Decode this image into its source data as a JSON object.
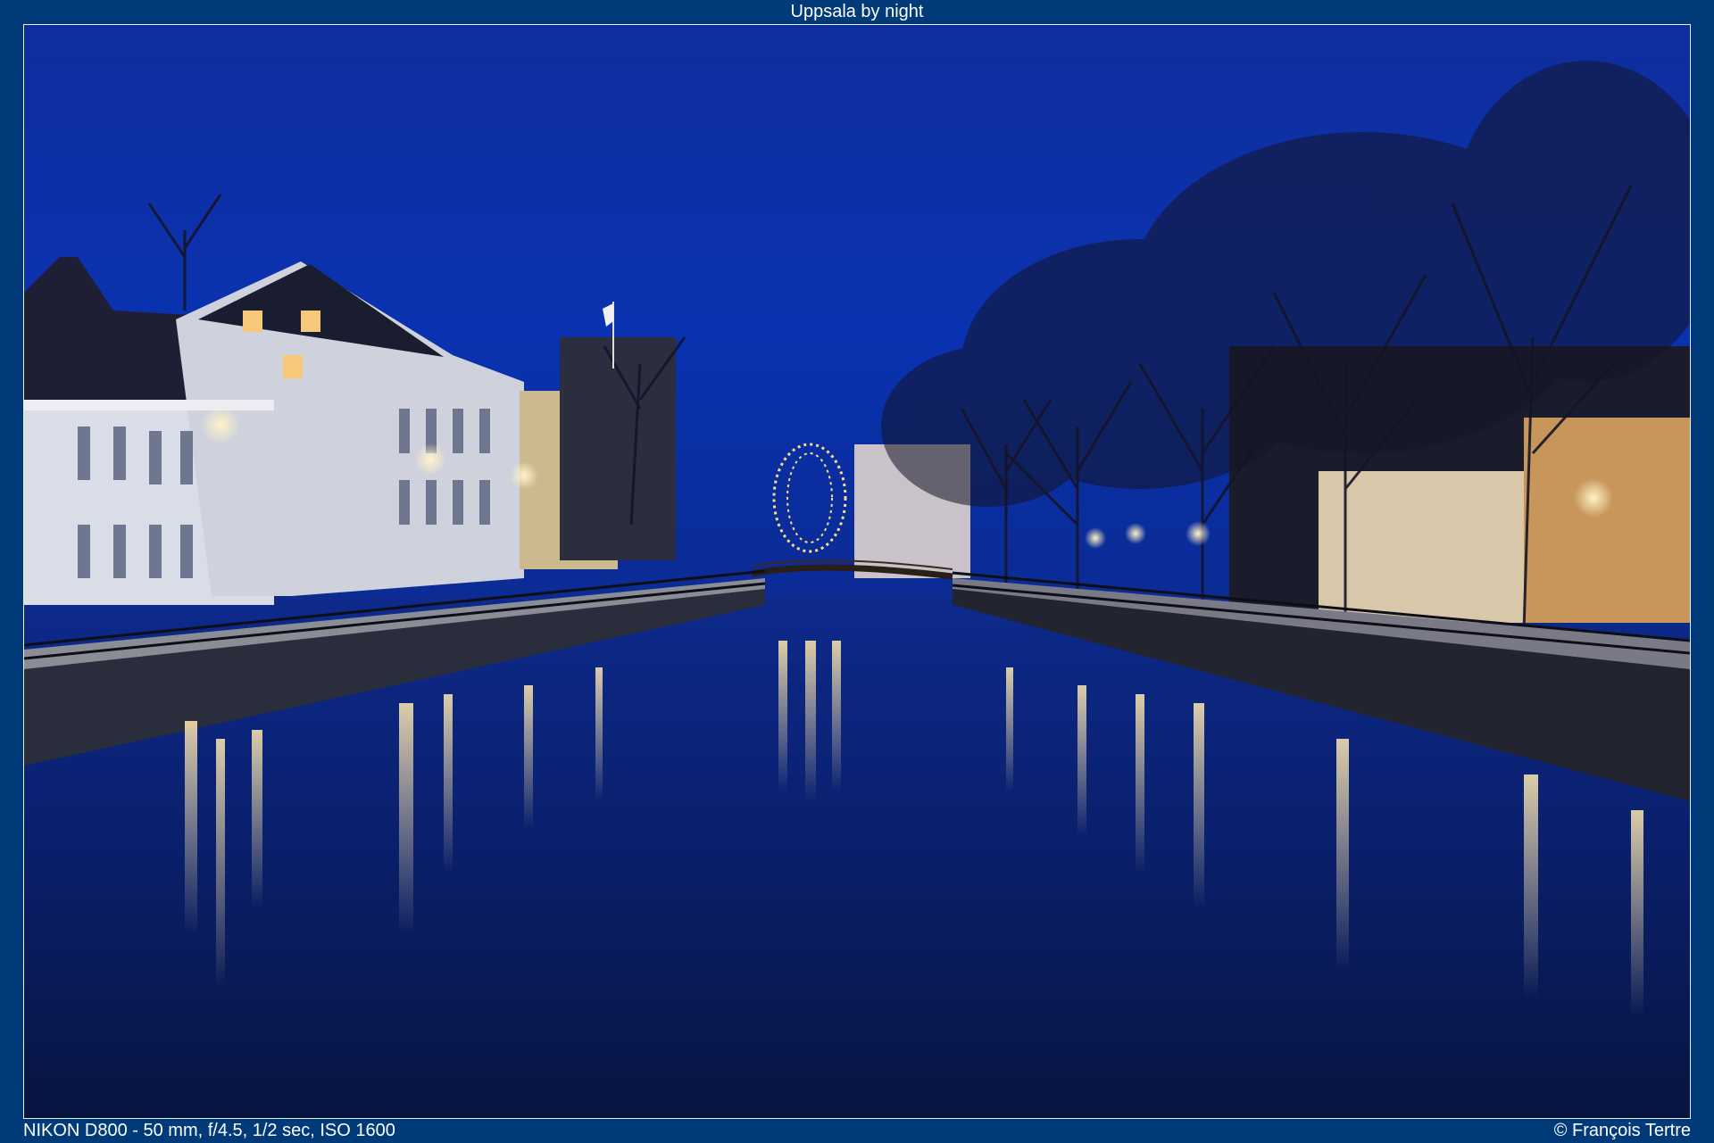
{
  "header": {
    "title": "Uppsala by night"
  },
  "footer": {
    "exif": "NIKON D800 - 50 mm, f/4.5, 1/2 sec, ISO 1600",
    "copyright": "© François Tertre"
  },
  "photo": {
    "subject": "Night view of a canal in Uppsala with illuminated buildings, bare trees and reflections in the water",
    "colors": {
      "frame": "#003a78",
      "sky": "#0a2aa0",
      "water": "#0b1a5a",
      "lights": "#ffe6a8"
    }
  }
}
